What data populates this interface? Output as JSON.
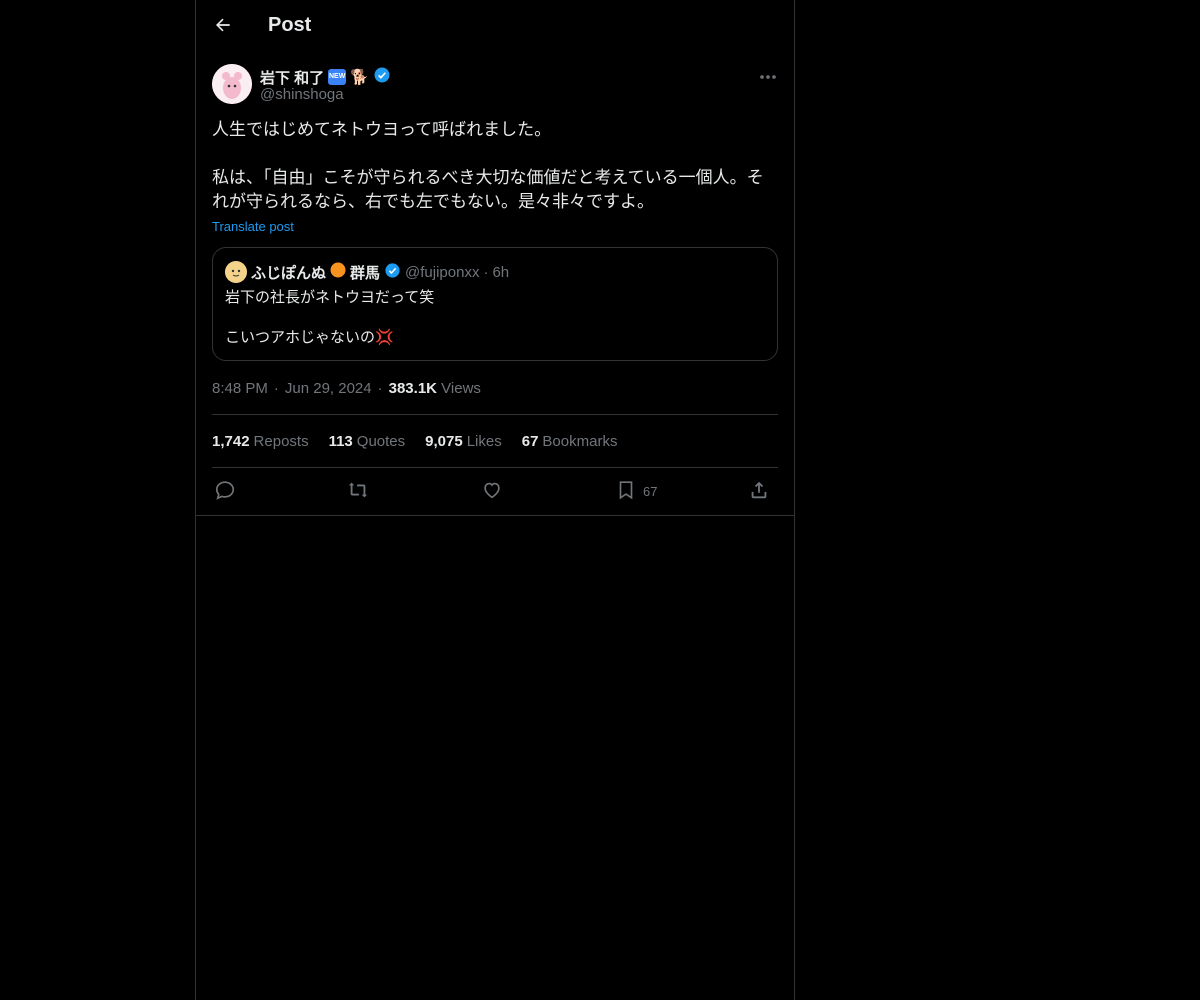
{
  "header": {
    "title": "Post"
  },
  "author": {
    "name": "岩下 和了",
    "handle": "@shinshoga",
    "badge_new": "NEW"
  },
  "post": {
    "text": "人生ではじめてネトウヨって呼ばれました。\n\n私は、「自由」こそが守られるべき大切な価値だと考えている一個人。それが守られるなら、右でも左でもない。是々非々ですよ。",
    "translate_label": "Translate post"
  },
  "quote": {
    "name": "ふじぽんぬ",
    "name_suffix": "群馬",
    "handle": "@fujiponxx",
    "separator": "·",
    "time": "6h",
    "text": "岩下の社長がネトウヨだって笑\n\nこいつアホじゃないの💢"
  },
  "meta": {
    "time": "8:48 PM",
    "dot": "·",
    "date": "Jun 29, 2024",
    "views_count": "383.1K",
    "views_label": "Views"
  },
  "stats": [
    {
      "count": "1,742",
      "label": "Reposts"
    },
    {
      "count": "113",
      "label": "Quotes"
    },
    {
      "count": "9,075",
      "label": "Likes"
    },
    {
      "count": "67",
      "label": "Bookmarks"
    }
  ],
  "actions": {
    "bookmark_count": "67"
  },
  "colors": {
    "accent": "#1d9bf0",
    "verified": "#1d9bf0",
    "text": "#e7e9ea",
    "muted": "#71767b",
    "border": "#2f3336"
  }
}
